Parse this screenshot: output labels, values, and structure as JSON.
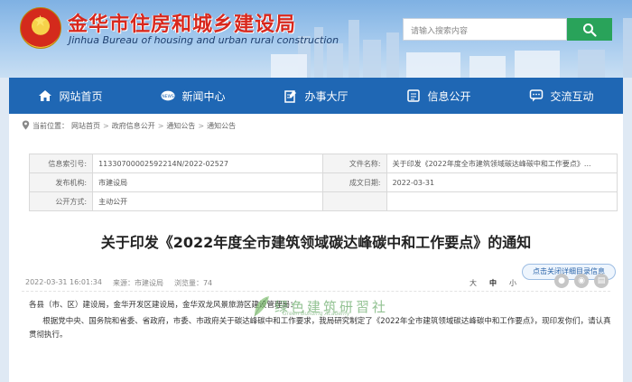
{
  "header": {
    "title": "金华市住房和城乡建设局",
    "subtitle": "Jinhua Bureau of housing and urban rural construction",
    "search_placeholder": "请输入搜索内容"
  },
  "nav": [
    {
      "label": "网站首页",
      "icon": "home-icon"
    },
    {
      "label": "新闻中心",
      "icon": "news-icon"
    },
    {
      "label": "办事大厅",
      "icon": "edit-icon"
    },
    {
      "label": "信息公开",
      "icon": "document-icon"
    },
    {
      "label": "交流互动",
      "icon": "chat-icon"
    }
  ],
  "breadcrumb": {
    "prefix": "当前位置：",
    "items": [
      "网站首页",
      "政府信息公开",
      "通知公告",
      "通知公告"
    ]
  },
  "meta": {
    "index_label": "信息索引号:",
    "index_value": "11330700002592214N/2022-02527",
    "file_label": "文件名称:",
    "file_value": "关于印发《2022年度全市建筑领域碳达峰碳中和工作要点》...",
    "org_label": "发布机构:",
    "org_value": "市建设局",
    "date_label": "成文日期:",
    "date_value": "2022-03-31",
    "mode_label": "公开方式:",
    "mode_value": "主动公开"
  },
  "article": {
    "title": "关于印发《2022年度全市建筑领域碳达峰碳中和工作要点》的通知",
    "toc_button": "点击关闭详细目录信息",
    "publish_time": "2022-03-31 16:01:34",
    "source": "来源：市建设局",
    "views": "浏览量：74",
    "font_large": "大",
    "font_medium": "中",
    "font_small": "小",
    "para1": "各县（市、区）建设局，金华开发区建设局，金华双龙风景旅游区建设管理局：",
    "para2": "根据党中央、国务院和省委、省政府，市委、市政府关于碳达峰碳中和工作要求，我局研究制定了《2022年全市建筑领域碳达峰碳中和工作要点》，现印发你们，请认真贯彻执行。"
  },
  "watermark": {
    "text": "绿色建筑研習社",
    "sub": "Green Building Academy"
  }
}
